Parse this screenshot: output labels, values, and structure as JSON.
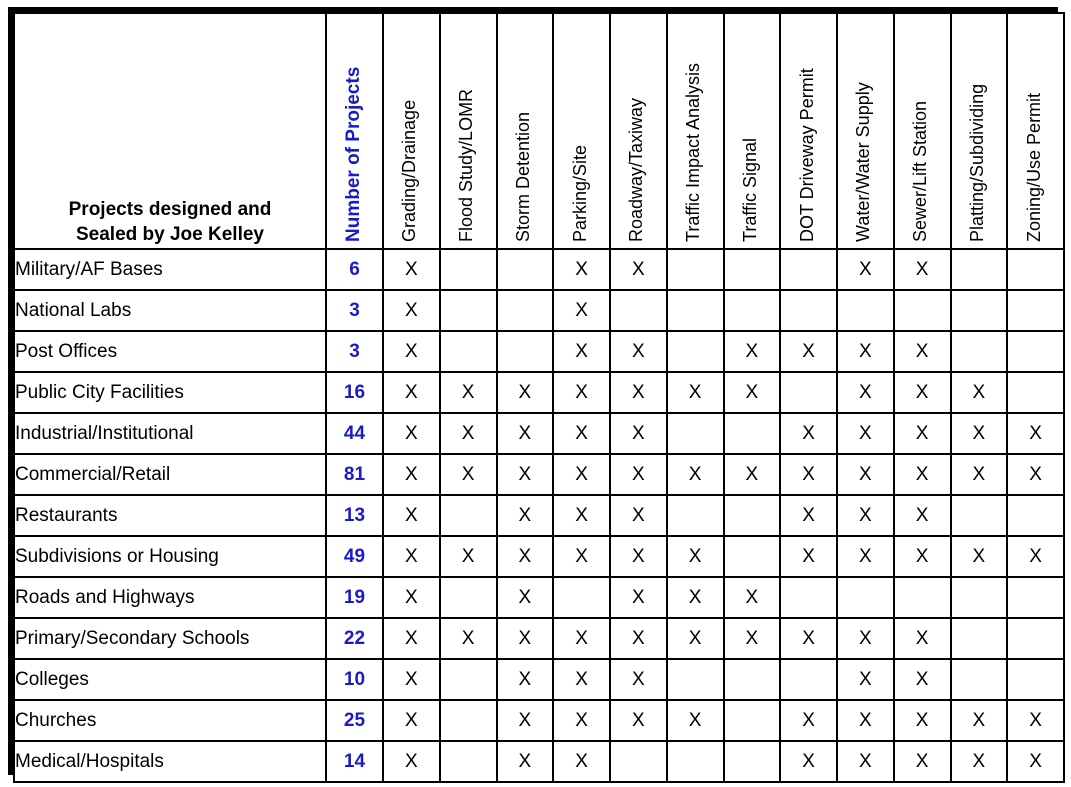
{
  "table": {
    "corner_header_lines": [
      "Projects designed and",
      "Sealed by Joe Kelley"
    ],
    "count_column_header": "Number of Projects",
    "mark_symbol": "X",
    "colors": {
      "accent_blue": "#1a1ac8",
      "text_black": "#000000",
      "background": "#ffffff",
      "border": "#000000"
    },
    "discipline_columns": [
      "Grading/Drainage",
      "Flood Study/LOMR",
      "Storm Detention",
      "Parking/Site",
      "Roadway/Taxiway",
      "Traffic Impact Analysis",
      "Traffic Signal",
      "DOT Driveway Permit",
      "Water/Water Supply",
      "Sewer/Lift Station",
      "Platting/Subdividing",
      "Zoning/Use Permit"
    ],
    "rows": [
      {
        "label": "Military/AF Bases",
        "count": "6",
        "marks": [
          true,
          false,
          false,
          true,
          true,
          false,
          false,
          false,
          true,
          true,
          false,
          false
        ]
      },
      {
        "label": "National Labs",
        "count": "3",
        "marks": [
          true,
          false,
          false,
          true,
          false,
          false,
          false,
          false,
          false,
          false,
          false,
          false
        ]
      },
      {
        "label": "Post Offices",
        "count": "3",
        "marks": [
          true,
          false,
          false,
          true,
          true,
          false,
          true,
          true,
          true,
          true,
          false,
          false
        ]
      },
      {
        "label": "Public City Facilities",
        "count": "16",
        "marks": [
          true,
          true,
          true,
          true,
          true,
          true,
          true,
          false,
          true,
          true,
          true,
          false
        ]
      },
      {
        "label": "Industrial/Institutional",
        "count": "44",
        "marks": [
          true,
          true,
          true,
          true,
          true,
          false,
          false,
          true,
          true,
          true,
          true,
          true
        ]
      },
      {
        "label": "Commercial/Retail",
        "count": "81",
        "marks": [
          true,
          true,
          true,
          true,
          true,
          true,
          true,
          true,
          true,
          true,
          true,
          true
        ]
      },
      {
        "label": "Restaurants",
        "count": "13",
        "marks": [
          true,
          false,
          true,
          true,
          true,
          false,
          false,
          true,
          true,
          true,
          false,
          false
        ]
      },
      {
        "label": "Subdivisions or Housing",
        "count": "49",
        "marks": [
          true,
          true,
          true,
          true,
          true,
          true,
          false,
          true,
          true,
          true,
          true,
          true
        ]
      },
      {
        "label": "Roads and Highways",
        "count": "19",
        "marks": [
          true,
          false,
          true,
          false,
          true,
          true,
          true,
          false,
          false,
          false,
          false,
          false
        ]
      },
      {
        "label": "Primary/Secondary Schools",
        "count": "22",
        "marks": [
          true,
          true,
          true,
          true,
          true,
          true,
          true,
          true,
          true,
          true,
          false,
          false
        ]
      },
      {
        "label": "Colleges",
        "count": "10",
        "marks": [
          true,
          false,
          true,
          true,
          true,
          false,
          false,
          false,
          true,
          true,
          false,
          false
        ]
      },
      {
        "label": "Churches",
        "count": "25",
        "marks": [
          true,
          false,
          true,
          true,
          true,
          true,
          false,
          true,
          true,
          true,
          true,
          true
        ]
      },
      {
        "label": "Medical/Hospitals",
        "count": "14",
        "marks": [
          true,
          false,
          true,
          true,
          false,
          false,
          false,
          true,
          true,
          true,
          true,
          true
        ]
      }
    ]
  }
}
